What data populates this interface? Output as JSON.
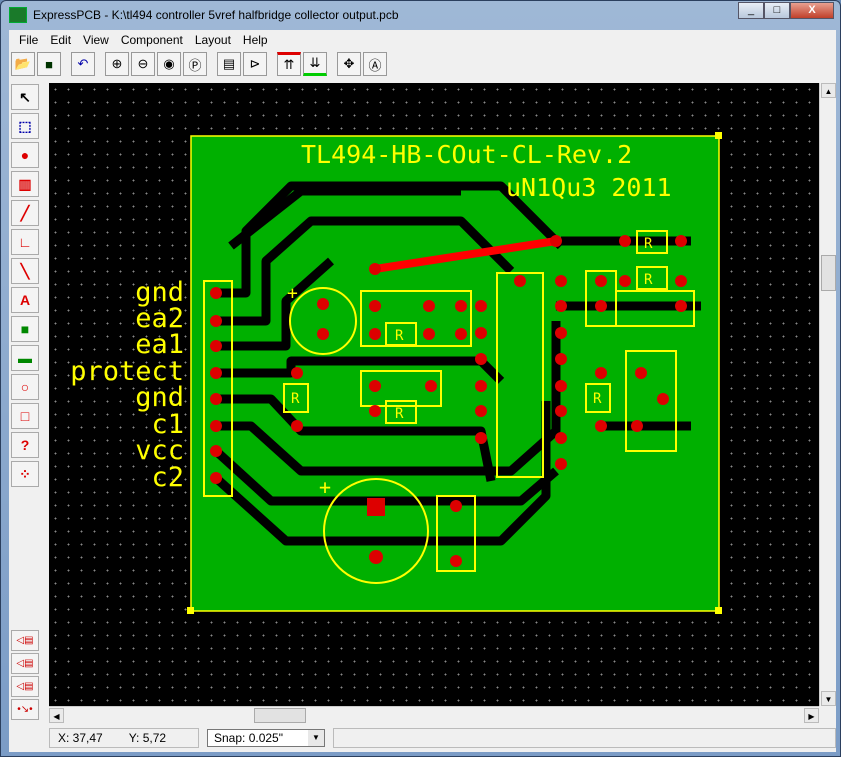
{
  "window": {
    "title": "ExpressPCB - K:\\tl494 controller 5vref halfbridge collector output.pcb",
    "buttons": [
      "_",
      "□",
      "X"
    ]
  },
  "menu": [
    "File",
    "Edit",
    "View",
    "Component",
    "Layout",
    "Help"
  ],
  "toolbar": [
    "open-icon",
    "save-icon",
    "undo-icon",
    "zoom-in-icon",
    "zoom-out-icon",
    "zoom-fit-icon",
    "zoom-page-icon",
    "properties-icon",
    "component-icon",
    "top-layer-icon",
    "bottom-layer-icon",
    "move-icon",
    "move-text-icon"
  ],
  "left_tools": [
    "select",
    "zoom-select",
    "place-pad",
    "place-component",
    "place-trace",
    "place-corner",
    "place-line",
    "place-text",
    "place-fill",
    "place-shape",
    "place-circle",
    "place-rect",
    "query",
    "netlist"
  ],
  "board": {
    "title": "TL494-HB-COut-CL-Rev.2",
    "subtitle": "uN1Qu3 2011",
    "pin_labels": [
      "gnd",
      "ea2",
      "ea1",
      "protect",
      "gnd",
      "c1",
      "vcc",
      "c2"
    ],
    "resistor_label": "R",
    "cap_plus": "+"
  },
  "colors": {
    "board": "#00b000",
    "trace": "#000000",
    "silk": "#ffff00",
    "pad": "#dd0000",
    "canvas": "#000000"
  },
  "status": {
    "x": "X: 37,47",
    "y": "Y: 5,72",
    "snap": "Snap:  0.025\""
  }
}
